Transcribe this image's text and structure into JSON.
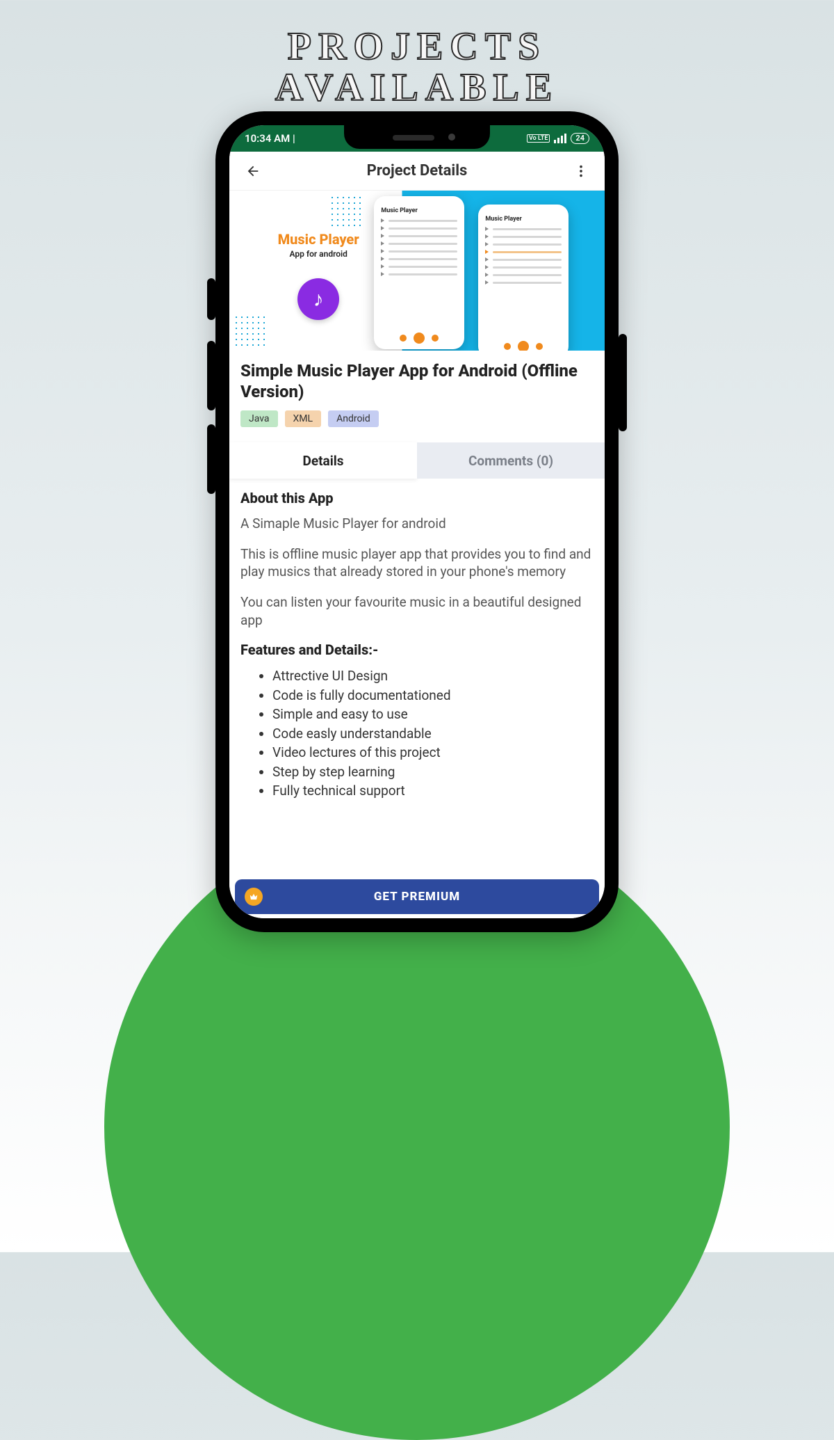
{
  "page_heading_line1": "PROJECTS",
  "page_heading_line2": "AVAILABLE",
  "statusbar": {
    "time": "10:34 AM |",
    "lte": "Vo LTE",
    "battery": "24"
  },
  "appbar": {
    "title": "Project Details"
  },
  "hero": {
    "brand_title": "Music Player",
    "brand_sub": "App for android",
    "mini_head": "Music Player"
  },
  "project": {
    "title": "Simple Music Player App for Android (Offline Version)",
    "chips": {
      "java": "Java",
      "xml": "XML",
      "android": "Android"
    }
  },
  "tabs": {
    "details": "Details",
    "comments": "Comments (0)"
  },
  "about": {
    "heading": "About this App",
    "p1": "A Simaple Music Player for android",
    "p2": "This is offline music player app that provides you to find and play musics that already stored in your phone's memory",
    "p3": "You can listen your favourite music in a beautiful designed app"
  },
  "features": {
    "heading": "Features and Details:-",
    "items": [
      "Attrective UI Design",
      "Code is fully documentationed",
      "Simple and easy to use",
      "Code easly understandable",
      "Video lectures of this project",
      "Step by step learning",
      "Fully technical support"
    ]
  },
  "premium_label": "GET PREMIUM"
}
